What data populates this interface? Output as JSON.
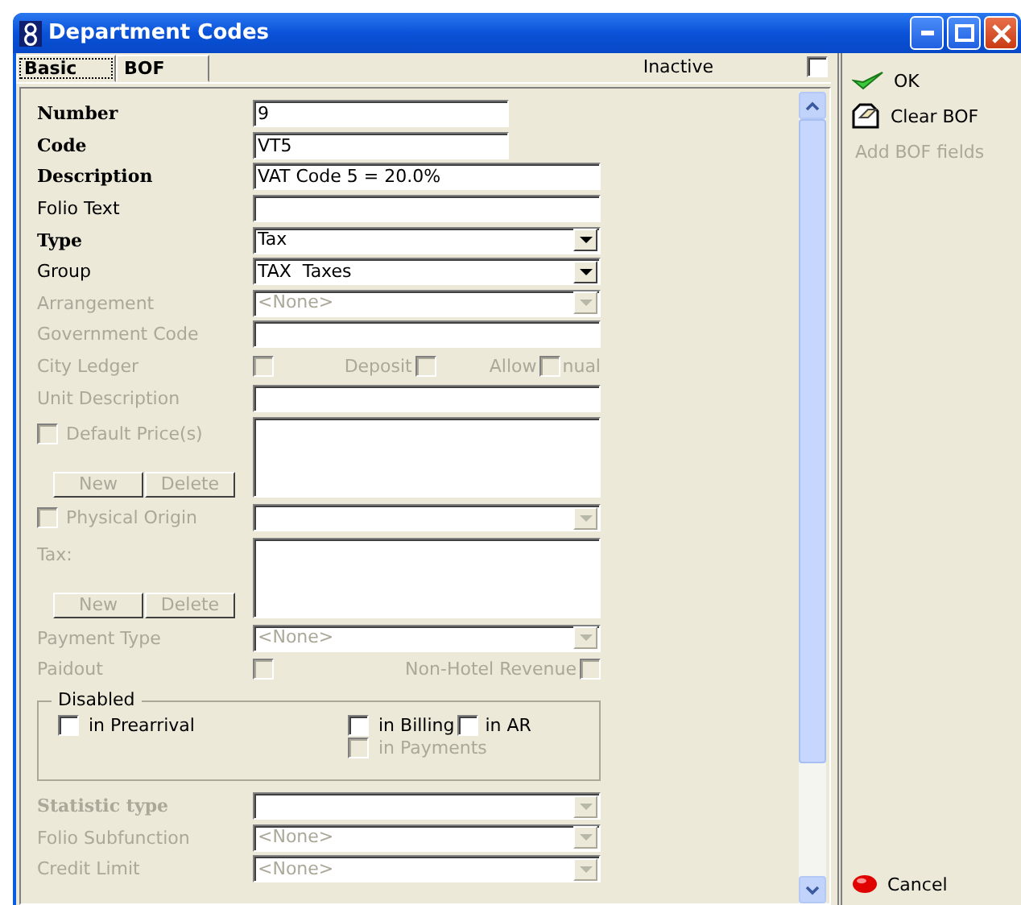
{
  "window": {
    "title": "Department Codes"
  },
  "tabs": [
    {
      "label": "Basic",
      "selected": true
    },
    {
      "label": "BOF",
      "selected": false
    }
  ],
  "inactive": {
    "label": "Inactive",
    "checked": false
  },
  "rows": [
    {
      "kind": "text",
      "label": "Number",
      "required": true,
      "disabled": false,
      "short": true,
      "value": "9"
    },
    {
      "kind": "text",
      "label": "Code",
      "required": true,
      "disabled": false,
      "short": true,
      "value": "VT5"
    },
    {
      "kind": "text",
      "label": "Description",
      "required": true,
      "disabled": false,
      "value": "VAT Code 5 = 20.0%"
    },
    {
      "kind": "text",
      "label": "Folio Text",
      "required": false,
      "disabled": false
    },
    {
      "kind": "combo",
      "label": "Type",
      "required": true,
      "disabled": false,
      "value": "Tax"
    },
    {
      "kind": "combo",
      "label": "Group",
      "required": false,
      "disabled": false,
      "value": "TAX  Taxes"
    },
    {
      "kind": "combo",
      "label": "Arrangement",
      "required": false,
      "disabled": true,
      "value": "<None>"
    },
    {
      "kind": "text",
      "label": "Government Code",
      "required": false,
      "disabled": true
    },
    {
      "kind": "checks",
      "label": "City Ledger",
      "required": false,
      "disabled": true,
      "checked": false,
      "items": [
        {
          "label": "Deposit",
          "checked": false
        },
        {
          "label": "Allow",
          "checked": false
        }
      ],
      "trailing": "nual"
    },
    {
      "kind": "text",
      "label": "Unit Description",
      "required": false,
      "disabled": true
    },
    {
      "kind": "check_list",
      "label": "Default Price(s)",
      "required": false,
      "disabled": true,
      "checked": false,
      "buttons": [
        "New",
        "Delete"
      ]
    },
    {
      "kind": "check_combo",
      "label": "Physical Origin",
      "required": false,
      "disabled": true,
      "checked": false
    },
    {
      "kind": "list",
      "label": "Tax:",
      "required": false,
      "disabled": true,
      "buttons": [
        "New",
        "Delete"
      ]
    },
    {
      "kind": "combo",
      "label": "Payment Type",
      "required": false,
      "disabled": true,
      "value": "<None>"
    },
    {
      "kind": "checks",
      "label": "Paidout",
      "required": false,
      "disabled": true,
      "checked": false,
      "items": [
        {
          "label": "Non-Hotel Revenue",
          "checked": false
        }
      ]
    },
    {
      "kind": "group",
      "label": "Disabled",
      "items": [
        {
          "label": "in Prearrival",
          "checked": false,
          "disabled": false
        },
        {
          "label": "in Billing",
          "checked": false,
          "disabled": false
        },
        {
          "label": "in AR",
          "checked": false,
          "disabled": false
        },
        {
          "label": "in Payments",
          "checked": false,
          "disabled": true
        }
      ]
    },
    {
      "kind": "combo",
      "label": "Statistic type",
      "required": true,
      "disabled": true
    },
    {
      "kind": "combo",
      "label": "Folio Subfunction",
      "required": false,
      "disabled": true,
      "value": "<None>"
    },
    {
      "kind": "combo",
      "label": "Credit Limit",
      "required": false,
      "disabled": true,
      "value": "<None>"
    }
  ],
  "actions": [
    {
      "kind": "ok",
      "label": "OK",
      "disabled": false
    },
    {
      "kind": "clear",
      "label": "Clear BOF",
      "disabled": false
    },
    {
      "kind": "plain",
      "label": "Add BOF fields",
      "disabled": true
    },
    {
      "kind": "cancel",
      "label": "Cancel",
      "disabled": false
    }
  ]
}
